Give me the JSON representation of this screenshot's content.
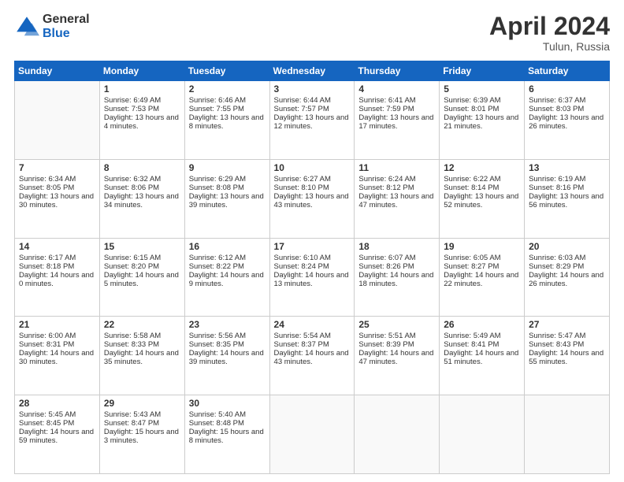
{
  "header": {
    "logo_general": "General",
    "logo_blue": "Blue",
    "month_title": "April 2024",
    "subtitle": "Tulun, Russia"
  },
  "days_of_week": [
    "Sunday",
    "Monday",
    "Tuesday",
    "Wednesday",
    "Thursday",
    "Friday",
    "Saturday"
  ],
  "weeks": [
    [
      {
        "day": "",
        "content": []
      },
      {
        "day": "1",
        "content": [
          "Sunrise: 6:49 AM",
          "Sunset: 7:53 PM",
          "Daylight: 13 hours and 4 minutes."
        ]
      },
      {
        "day": "2",
        "content": [
          "Sunrise: 6:46 AM",
          "Sunset: 7:55 PM",
          "Daylight: 13 hours and 8 minutes."
        ]
      },
      {
        "day": "3",
        "content": [
          "Sunrise: 6:44 AM",
          "Sunset: 7:57 PM",
          "Daylight: 13 hours and 12 minutes."
        ]
      },
      {
        "day": "4",
        "content": [
          "Sunrise: 6:41 AM",
          "Sunset: 7:59 PM",
          "Daylight: 13 hours and 17 minutes."
        ]
      },
      {
        "day": "5",
        "content": [
          "Sunrise: 6:39 AM",
          "Sunset: 8:01 PM",
          "Daylight: 13 hours and 21 minutes."
        ]
      },
      {
        "day": "6",
        "content": [
          "Sunrise: 6:37 AM",
          "Sunset: 8:03 PM",
          "Daylight: 13 hours and 26 minutes."
        ]
      }
    ],
    [
      {
        "day": "7",
        "content": [
          "Sunrise: 6:34 AM",
          "Sunset: 8:05 PM",
          "Daylight: 13 hours and 30 minutes."
        ]
      },
      {
        "day": "8",
        "content": [
          "Sunrise: 6:32 AM",
          "Sunset: 8:06 PM",
          "Daylight: 13 hours and 34 minutes."
        ]
      },
      {
        "day": "9",
        "content": [
          "Sunrise: 6:29 AM",
          "Sunset: 8:08 PM",
          "Daylight: 13 hours and 39 minutes."
        ]
      },
      {
        "day": "10",
        "content": [
          "Sunrise: 6:27 AM",
          "Sunset: 8:10 PM",
          "Daylight: 13 hours and 43 minutes."
        ]
      },
      {
        "day": "11",
        "content": [
          "Sunrise: 6:24 AM",
          "Sunset: 8:12 PM",
          "Daylight: 13 hours and 47 minutes."
        ]
      },
      {
        "day": "12",
        "content": [
          "Sunrise: 6:22 AM",
          "Sunset: 8:14 PM",
          "Daylight: 13 hours and 52 minutes."
        ]
      },
      {
        "day": "13",
        "content": [
          "Sunrise: 6:19 AM",
          "Sunset: 8:16 PM",
          "Daylight: 13 hours and 56 minutes."
        ]
      }
    ],
    [
      {
        "day": "14",
        "content": [
          "Sunrise: 6:17 AM",
          "Sunset: 8:18 PM",
          "Daylight: 14 hours and 0 minutes."
        ]
      },
      {
        "day": "15",
        "content": [
          "Sunrise: 6:15 AM",
          "Sunset: 8:20 PM",
          "Daylight: 14 hours and 5 minutes."
        ]
      },
      {
        "day": "16",
        "content": [
          "Sunrise: 6:12 AM",
          "Sunset: 8:22 PM",
          "Daylight: 14 hours and 9 minutes."
        ]
      },
      {
        "day": "17",
        "content": [
          "Sunrise: 6:10 AM",
          "Sunset: 8:24 PM",
          "Daylight: 14 hours and 13 minutes."
        ]
      },
      {
        "day": "18",
        "content": [
          "Sunrise: 6:07 AM",
          "Sunset: 8:26 PM",
          "Daylight: 14 hours and 18 minutes."
        ]
      },
      {
        "day": "19",
        "content": [
          "Sunrise: 6:05 AM",
          "Sunset: 8:27 PM",
          "Daylight: 14 hours and 22 minutes."
        ]
      },
      {
        "day": "20",
        "content": [
          "Sunrise: 6:03 AM",
          "Sunset: 8:29 PM",
          "Daylight: 14 hours and 26 minutes."
        ]
      }
    ],
    [
      {
        "day": "21",
        "content": [
          "Sunrise: 6:00 AM",
          "Sunset: 8:31 PM",
          "Daylight: 14 hours and 30 minutes."
        ]
      },
      {
        "day": "22",
        "content": [
          "Sunrise: 5:58 AM",
          "Sunset: 8:33 PM",
          "Daylight: 14 hours and 35 minutes."
        ]
      },
      {
        "day": "23",
        "content": [
          "Sunrise: 5:56 AM",
          "Sunset: 8:35 PM",
          "Daylight: 14 hours and 39 minutes."
        ]
      },
      {
        "day": "24",
        "content": [
          "Sunrise: 5:54 AM",
          "Sunset: 8:37 PM",
          "Daylight: 14 hours and 43 minutes."
        ]
      },
      {
        "day": "25",
        "content": [
          "Sunrise: 5:51 AM",
          "Sunset: 8:39 PM",
          "Daylight: 14 hours and 47 minutes."
        ]
      },
      {
        "day": "26",
        "content": [
          "Sunrise: 5:49 AM",
          "Sunset: 8:41 PM",
          "Daylight: 14 hours and 51 minutes."
        ]
      },
      {
        "day": "27",
        "content": [
          "Sunrise: 5:47 AM",
          "Sunset: 8:43 PM",
          "Daylight: 14 hours and 55 minutes."
        ]
      }
    ],
    [
      {
        "day": "28",
        "content": [
          "Sunrise: 5:45 AM",
          "Sunset: 8:45 PM",
          "Daylight: 14 hours and 59 minutes."
        ]
      },
      {
        "day": "29",
        "content": [
          "Sunrise: 5:43 AM",
          "Sunset: 8:47 PM",
          "Daylight: 15 hours and 3 minutes."
        ]
      },
      {
        "day": "30",
        "content": [
          "Sunrise: 5:40 AM",
          "Sunset: 8:48 PM",
          "Daylight: 15 hours and 8 minutes."
        ]
      },
      {
        "day": "",
        "content": []
      },
      {
        "day": "",
        "content": []
      },
      {
        "day": "",
        "content": []
      },
      {
        "day": "",
        "content": []
      }
    ]
  ]
}
